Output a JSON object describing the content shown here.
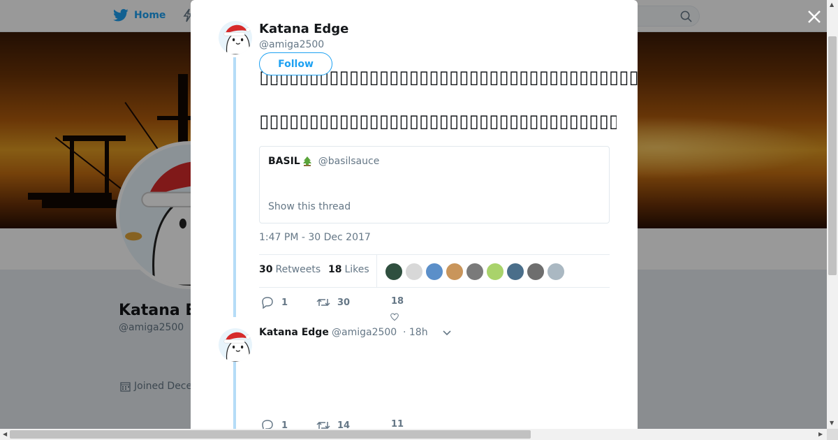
{
  "nav": {
    "home_label": "Home",
    "icons": [
      "twitter-bird-icon",
      "lightning-icon",
      "search-icon"
    ]
  },
  "profile": {
    "name": "Katana E",
    "handle": "@amiga2500",
    "joined": "Joined Dece"
  },
  "tweet": {
    "author_name": "Katana Edge",
    "author_handle": "@amiga2500",
    "follow_label": "Follow",
    "text_line_1": "▯▯▯▯▯▯▯▯▯▯▯▯▯▯▯▯▯▯▯▯▯▯▯▯▯▯▯▯▯▯▯▯▯▯▯▯▯▯▯▯▯▯▯▯▯▯",
    "text_line_2": "▯▯▯▯▯▯▯▯▯▯▯▯▯▯▯▯▯▯▯▯▯▯▯▯▯▯▯▯▯▯▯▯▯▯▯▯▯▯▯▯▯▯▯▯▯▯",
    "quote": {
      "name": "BASIL",
      "handle": "@basilsauce",
      "show_thread": "Show this thread"
    },
    "timestamp": "1:47 PM - 30 Dec 2017",
    "retweets_count": "30",
    "retweets_label": "Retweets",
    "likes_count": "18",
    "likes_label": "Likes",
    "liker_colors": [
      "#2f4f3f",
      "#d8d8d8",
      "#5b8fc9",
      "#c9955b",
      "#7a7a7a",
      "#a9d36b",
      "#4a6e8a",
      "#6e6e6e",
      "#aab8c2"
    ],
    "actions": {
      "replies": "1",
      "retweets": "30",
      "likes": "18"
    }
  },
  "reply_tweet": {
    "name": "Katana Edge",
    "handle": "@amiga2500",
    "time": "· 18h",
    "actions": {
      "replies": "1",
      "retweets": "14",
      "likes": "11"
    }
  },
  "colors": {
    "accent": "#1da1f2",
    "thread_line": "#b5dcf7",
    "overlay": "rgba(0,0,0,0.4)"
  }
}
